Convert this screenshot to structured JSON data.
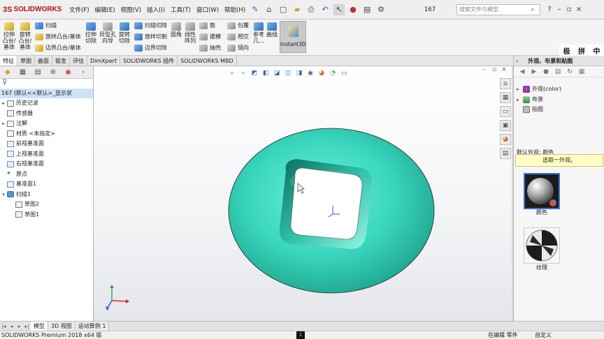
{
  "app": {
    "logo_text": "SOLIDWORKS",
    "logo_mark": "3S"
  },
  "menu": [
    "文件(F)",
    "编辑(E)",
    "视图(V)",
    "插入(I)",
    "工具(T)",
    "窗口(W)",
    "帮助(H)"
  ],
  "toolbar": {
    "doc_number": "167",
    "search_placeholder": "搜索文件与模型"
  },
  "ribbon": {
    "extrude_boss": "拉伸凸台/基体",
    "revolve_boss": "旋转凸台/基体",
    "sweep": "扫描",
    "loft_boss": "放样凸台/基体",
    "boundary_boss": "边界凸台/基体",
    "extrude_cut": "拉伸切除",
    "hole_wizard": "异型孔向导",
    "revolve_cut": "旋转切除",
    "sweep_cut": "扫描切除",
    "loft_cut": "放样切割",
    "boundary_cut": "边界切除",
    "fillet": "圆角",
    "linear_pattern": "线性阵列",
    "rib": "筋",
    "draft": "拔模",
    "shell": "抽壳",
    "wrap": "包覆",
    "intersect": "相交",
    "mirror": "镜向",
    "ref_geom": "参考几...",
    "curves": "曲线",
    "instant3d": "Instant3D"
  },
  "language_bar": [
    "极",
    "拼",
    "中"
  ],
  "command_tabs": [
    "特征",
    "草图",
    "曲面",
    "钣金",
    "评估",
    "DimXpert",
    "SOLIDWORKS 插件",
    "SOLIDWORKS MBD"
  ],
  "feature_tree": {
    "root": "167 (默认<<默认>_显示状",
    "items": [
      {
        "label": "历史记录",
        "arrow": "▸"
      },
      {
        "label": "传感器",
        "arrow": ""
      },
      {
        "label": "注解",
        "arrow": "▸"
      },
      {
        "label": "材质 <未指定>",
        "arrow": ""
      },
      {
        "label": "前视基准面",
        "arrow": ""
      },
      {
        "label": "上视基准面",
        "arrow": ""
      },
      {
        "label": "右视基准面",
        "arrow": ""
      },
      {
        "label": "原点",
        "arrow": ""
      },
      {
        "label": "基准面1",
        "arrow": ""
      },
      {
        "label": "扫描1",
        "arrow": "▾"
      },
      {
        "label": "草图2",
        "arrow": ""
      },
      {
        "label": "草图1",
        "arrow": ""
      }
    ]
  },
  "task_pane": {
    "title": "外观、布景和贴图",
    "tree": [
      {
        "label": "外观(color)",
        "arrow": "▸"
      },
      {
        "label": "布景",
        "arrow": "▸"
      },
      {
        "label": "贴图",
        "arrow": ""
      }
    ],
    "default_label": "默认外观: 颜色",
    "hint": "选取一外观。",
    "thumbs": [
      "颜色",
      "纹理"
    ]
  },
  "bottom_tabs": [
    "模型",
    "3D 视图",
    "运动算例 1"
  ],
  "status": {
    "left": "SOLIDWORKS Premium 2018 x64 版",
    "mid": "在编辑 零件",
    "right": "自定义",
    "black_box": "1"
  },
  "colors": {
    "model": "#33d1b8",
    "model_dark": "#1f9f8b",
    "selection_blue": "#3477d6"
  }
}
